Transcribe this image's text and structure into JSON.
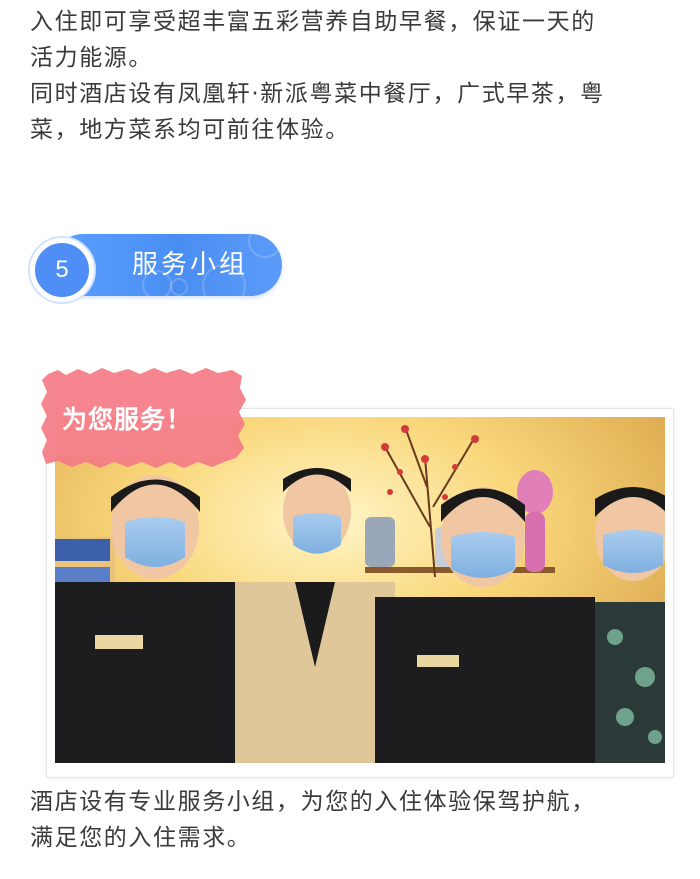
{
  "article": {
    "para_intro": "入住即可享受超丰富五彩营养自助早餐，保证一天的活力能源。同时酒店设有凤凰轩·新派粤菜中餐厅，广式早茶，粤菜，地方菜系均可前往体验。",
    "para_intro_lines": [
      "入住即可享受超丰富五彩营养自助早餐，保证一天的",
      "活力能源。",
      "同时酒店设有凤凰轩·新派粤菜中餐厅，广式早茶，粤",
      "菜，地方菜系均可前往体验。"
    ],
    "section": {
      "number": "5",
      "title": "服务小组"
    },
    "photo_tag": "为您服务！",
    "para_service_lines": [
      "酒店设有专业服务小组，为您的入住体验保驾护航，",
      "满足您的入住需求。"
    ]
  },
  "colors": {
    "text": "#3a3a3a",
    "badge_blue": "#4f8ff5",
    "tag_pink": "#f47b86"
  },
  "icons": {
    "photo": "staff-group-photo"
  }
}
